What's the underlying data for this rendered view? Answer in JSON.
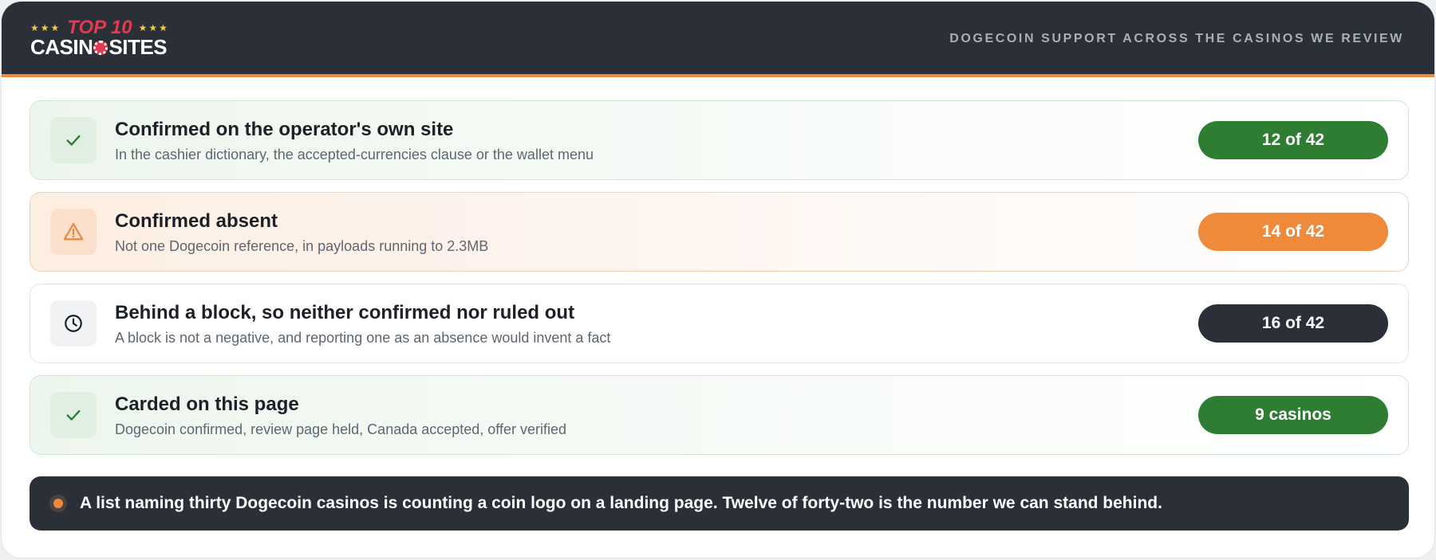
{
  "brand": {
    "stars": "★★★",
    "top_line": "TOP 10",
    "bottom_left": "CASIN",
    "bottom_right": "SITES"
  },
  "header": {
    "caption": "DOGECOIN SUPPORT ACROSS THE CASINOS WE REVIEW"
  },
  "rows": [
    {
      "title": "Confirmed on the operator's own site",
      "subtitle": "In the cashier dictionary, the accepted-currencies clause or the wallet menu",
      "value": "12 of 42",
      "icon": "check-icon",
      "tone": "green"
    },
    {
      "title": "Confirmed absent",
      "subtitle": "Not one Dogecoin reference, in payloads running to 2.3MB",
      "value": "14 of 42",
      "icon": "warning-icon",
      "tone": "orange"
    },
    {
      "title": "Behind a block, so neither confirmed nor ruled out",
      "subtitle": "A block is not a negative, and reporting one as an absence would invent a fact",
      "value": "16 of 42",
      "icon": "clock-icon",
      "tone": "neutral"
    },
    {
      "title": "Carded on this page",
      "subtitle": "Dogecoin confirmed, review page held, Canada accepted, offer verified",
      "value": "9 casinos",
      "icon": "check-icon",
      "tone": "green"
    }
  ],
  "footer": {
    "text": "A list naming thirty Dogecoin casinos is counting a coin logo on a landing page. Twelve of forty-two is the number we can stand behind."
  },
  "colors": {
    "header_bg": "#2a2f38",
    "accent_orange": "#ef8a3a",
    "green": "#2e7d32",
    "logo_red": "#e23a4e",
    "star_gold": "#f2c94c"
  }
}
